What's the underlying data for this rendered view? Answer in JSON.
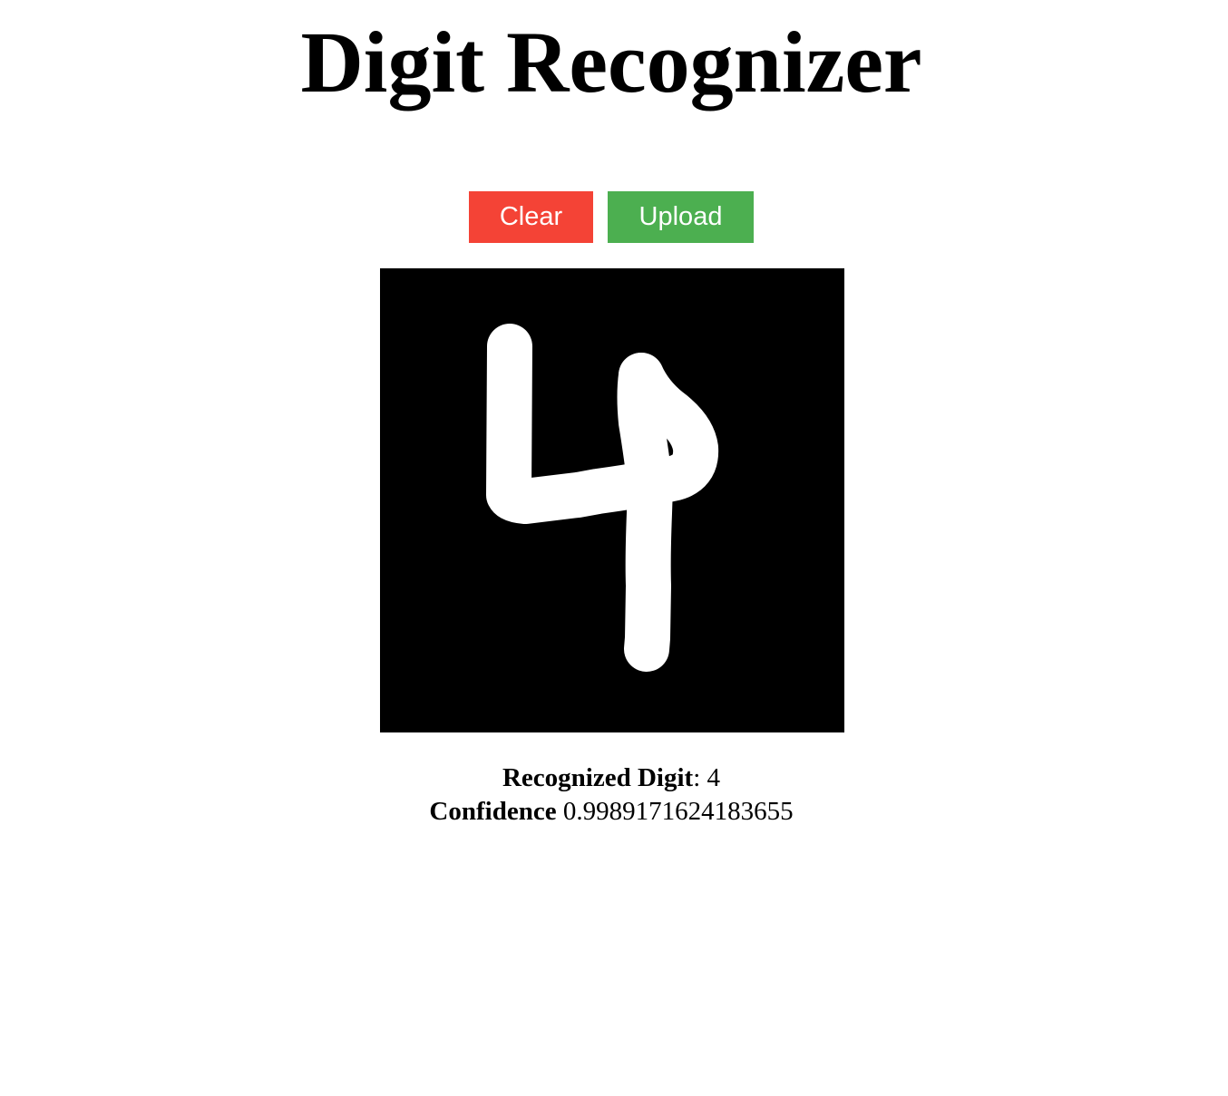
{
  "page": {
    "title": "Digit Recognizer"
  },
  "toolbar": {
    "clear_label": "Clear",
    "upload_label": "Upload",
    "clear_color": "#f44336",
    "upload_color": "#4caf50"
  },
  "canvas": {
    "background": "#000000",
    "stroke_color": "#ffffff",
    "drawn_digit": "4"
  },
  "result": {
    "digit_label": "Recognized Digit",
    "digit_separator": ": ",
    "digit_value": "4",
    "confidence_label": "Confidence",
    "confidence_value": "0.9989171624183655"
  }
}
